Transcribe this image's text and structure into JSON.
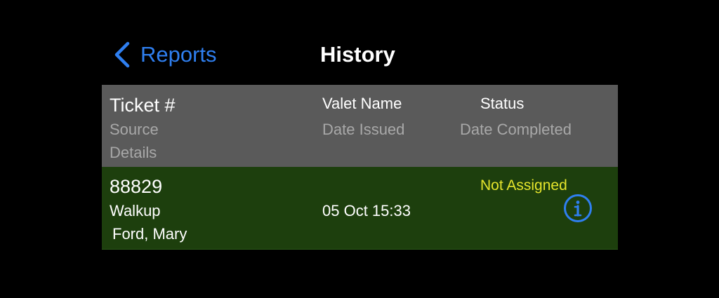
{
  "nav": {
    "back_label": "Reports",
    "title": "History",
    "back_icon": "chevron-left-icon"
  },
  "table": {
    "header": {
      "ticket": "Ticket #",
      "valet_name": "Valet Name",
      "status": "Status",
      "source": "Source",
      "date_issued": "Date Issued",
      "date_completed": "Date Completed",
      "details": "Details"
    },
    "rows": [
      {
        "ticket": "88829",
        "source": "Walkup",
        "date_issued": "05 Oct 15:33",
        "details": "Ford, Mary",
        "status": "Not Assigned",
        "info_icon": "info-circle-icon"
      }
    ]
  },
  "colors": {
    "background": "#000000",
    "accent_blue": "#2f7ff0",
    "header_bg": "#5a5a5a",
    "row_bg": "#1d3f0d",
    "status_yellow": "#e6e62c"
  }
}
